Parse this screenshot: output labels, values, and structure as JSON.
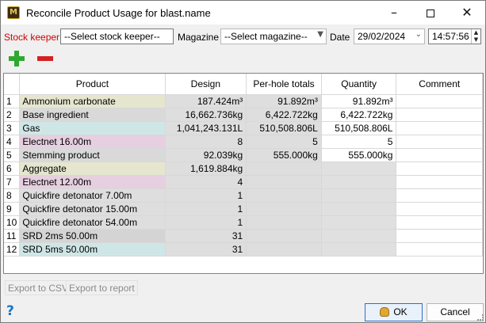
{
  "window": {
    "title": "Reconcile Product Usage for  blast.name"
  },
  "toolbar": {
    "stock_keeper_label": "Stock keeper",
    "stock_keeper_value": "--Select stock keeper--",
    "magazine_label": "Magazine",
    "magazine_value": "--Select magazine--",
    "date_label": "Date",
    "date_value": "29/02/2024",
    "time_value": "14:57:56"
  },
  "colors": {
    "stock_keeper_label": "#d40000",
    "add": "#2fa82f",
    "remove": "#d42020",
    "ok_border": "#2b6fc9"
  },
  "table": {
    "headers": [
      "Product",
      "Design",
      "Per-hole totals",
      "Quantity",
      "Comment"
    ],
    "rows": [
      {
        "num": "1",
        "product": "Ammonium carbonate",
        "design": "187.424m³",
        "per_hole": "91.892m³",
        "quantity": "91.892m³",
        "comment": "",
        "color": "#e6e6cf"
      },
      {
        "num": "2",
        "product": "Base ingredient",
        "design": "16,662.736kg",
        "per_hole": "6,422.722kg",
        "quantity": "6,422.722kg",
        "comment": "",
        "color": "#d9d9d9"
      },
      {
        "num": "3",
        "product": "Gas",
        "design": "1,041,243.131L",
        "per_hole": "510,508.806L",
        "quantity": "510,508.806L",
        "comment": "",
        "color": "#cfe6e6"
      },
      {
        "num": "4",
        "product": "Electnet 16.00m",
        "design": "8",
        "per_hole": "5",
        "quantity": "5",
        "comment": "",
        "color": "#e6cfe0"
      },
      {
        "num": "5",
        "product": "Stemming product",
        "design": "92.039kg",
        "per_hole": "555.000kg",
        "quantity": "555.000kg",
        "comment": "",
        "color": "#d9d9d9"
      },
      {
        "num": "6",
        "product": "Aggregate",
        "design": "1,619.884kg",
        "per_hole": "",
        "quantity": "",
        "comment": "",
        "color": "#e6e6cf"
      },
      {
        "num": "7",
        "product": "Electnet 12.00m",
        "design": "4",
        "per_hole": "",
        "quantity": "",
        "comment": "",
        "color": "#e6cfe0"
      },
      {
        "num": "8",
        "product": "Quickfire detonator 7.00m",
        "design": "1",
        "per_hole": "",
        "quantity": "",
        "comment": "",
        "color": "#dedede"
      },
      {
        "num": "9",
        "product": "Quickfire detonator 15.00m",
        "design": "1",
        "per_hole": "",
        "quantity": "",
        "comment": "",
        "color": "#dedede"
      },
      {
        "num": "10",
        "product": "Quickfire detonator 54.00m",
        "design": "1",
        "per_hole": "",
        "quantity": "",
        "comment": "",
        "color": "#dedede"
      },
      {
        "num": "11",
        "product": "SRD 2ms 50.00m",
        "design": "31",
        "per_hole": "",
        "quantity": "",
        "comment": "",
        "color": "#d4d4d4"
      },
      {
        "num": "12",
        "product": "SRD 5ms 50.00m",
        "design": "31",
        "per_hole": "",
        "quantity": "",
        "comment": "",
        "color": "#cfe6e6"
      }
    ]
  },
  "footer": {
    "export_csv": "Export to CSV",
    "export_report": "Export to report",
    "ok": "OK",
    "cancel": "Cancel"
  }
}
